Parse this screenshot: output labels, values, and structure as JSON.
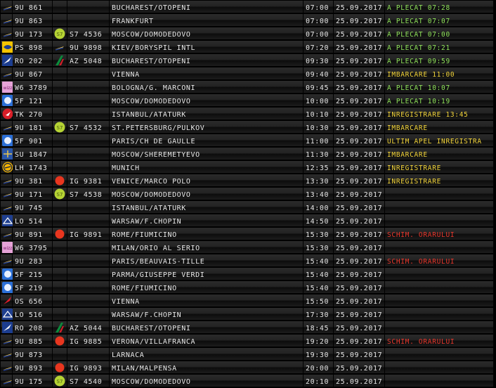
{
  "colors": {
    "status_green": "#8fe25a",
    "status_yellow": "#f2d43a",
    "status_red": "#e8362b",
    "text": "#e9e9e9"
  },
  "flights": [
    {
      "airline_icon": "tarom-icon",
      "flight": "9U 861",
      "codeshare_icon": "",
      "codeshare": "",
      "destination": "BUCHAREST/OTOPENI",
      "time": "07:00",
      "date": "25.09.2017",
      "status": "A PLECAT 07:28",
      "status_color": "green"
    },
    {
      "airline_icon": "tarom-icon",
      "flight": "9U 863",
      "codeshare_icon": "",
      "codeshare": "",
      "destination": "FRANKFURT",
      "time": "07:00",
      "date": "25.09.2017",
      "status": "A PLECAT 07:07",
      "status_color": "green"
    },
    {
      "airline_icon": "tarom-icon",
      "flight": "9U 173",
      "codeshare_icon": "s7-icon",
      "codeshare": "S7 4536",
      "destination": "MOSCOW/DOMODEDOVO",
      "time": "07:00",
      "date": "25.09.2017",
      "status": "A PLECAT 07:00",
      "status_color": "green"
    },
    {
      "airline_icon": "uia-icon",
      "flight": "PS 898",
      "codeshare_icon": "tarom-icon",
      "codeshare": "9U 9898",
      "destination": "KIEV/BORYSPIL INTL",
      "time": "07:20",
      "date": "25.09.2017",
      "status": "A PLECAT 07:21",
      "status_color": "green"
    },
    {
      "airline_icon": "tarom-ro-icon",
      "flight": "RO 202",
      "codeshare_icon": "alitalia-icon",
      "codeshare": "AZ 5048",
      "destination": "BUCHAREST/OTOPENI",
      "time": "09:30",
      "date": "25.09.2017",
      "status": "A PLECAT 09:59",
      "status_color": "green"
    },
    {
      "airline_icon": "tarom-icon",
      "flight": "9U 867",
      "codeshare_icon": "",
      "codeshare": "",
      "destination": "VIENNA",
      "time": "09:40",
      "date": "25.09.2017",
      "status": "IMBARCARE 11:00",
      "status_color": "yellow"
    },
    {
      "airline_icon": "wizz-icon",
      "flight": "W6 3789",
      "codeshare_icon": "",
      "codeshare": "",
      "destination": "BOLOGNA/G. MARCONI",
      "time": "09:45",
      "date": "25.09.2017",
      "status": "A PLECAT 10:07",
      "status_color": "green"
    },
    {
      "airline_icon": "s7-blue-icon",
      "flight": "5F 121",
      "codeshare_icon": "",
      "codeshare": "",
      "destination": "MOSCOW/DOMODEDOVO",
      "time": "10:00",
      "date": "25.09.2017",
      "status": "A PLECAT 10:19",
      "status_color": "green"
    },
    {
      "airline_icon": "turkish-icon",
      "flight": "TK 270",
      "codeshare_icon": "",
      "codeshare": "",
      "destination": "ISTANBUL/ATATURK",
      "time": "10:10",
      "date": "25.09.2017",
      "status": "INREGISTRARE 13:45",
      "status_color": "yellow"
    },
    {
      "airline_icon": "tarom-icon",
      "flight": "9U 181",
      "codeshare_icon": "s7-icon",
      "codeshare": "S7 4532",
      "destination": "ST.PETERSBURG/PULKOV",
      "time": "10:30",
      "date": "25.09.2017",
      "status": "IMBARCARE",
      "status_color": "yellow"
    },
    {
      "airline_icon": "s7-blue-icon",
      "flight": "5F 901",
      "codeshare_icon": "",
      "codeshare": "",
      "destination": "PARIS/CH DE GAULLE",
      "time": "11:00",
      "date": "25.09.2017",
      "status": "ULTIM APEL INREGISTRA",
      "status_color": "yellow"
    },
    {
      "airline_icon": "aeroflot-icon",
      "flight": "SU 1847",
      "codeshare_icon": "",
      "codeshare": "",
      "destination": "MOSCOW/SHEREMETYEVO",
      "time": "11:30",
      "date": "25.09.2017",
      "status": "IMBARCARE",
      "status_color": "yellow"
    },
    {
      "airline_icon": "lufthansa-icon",
      "flight": "LH 1743",
      "codeshare_icon": "",
      "codeshare": "",
      "destination": "MUNICH",
      "time": "12:35",
      "date": "25.09.2017",
      "status": "INREGISTRARE",
      "status_color": "yellow"
    },
    {
      "airline_icon": "tarom-icon",
      "flight": "9U 381",
      "codeshare_icon": "airone-icon",
      "codeshare": "IG 9381",
      "destination": "VENICE/MARCO POLO",
      "time": "13:30",
      "date": "25.09.2017",
      "status": "INREGISTRARE",
      "status_color": "yellow"
    },
    {
      "airline_icon": "tarom-icon",
      "flight": "9U 171",
      "codeshare_icon": "s7-icon",
      "codeshare": "S7 4538",
      "destination": "MOSCOW/DOMODEDOVO",
      "time": "13:40",
      "date": "25.09.2017",
      "status": "",
      "status_color": "yellow"
    },
    {
      "airline_icon": "tarom-icon",
      "flight": "9U 745",
      "codeshare_icon": "",
      "codeshare": "",
      "destination": "ISTANBUL/ATATURK",
      "time": "14:00",
      "date": "25.09.2017",
      "status": "",
      "status_color": "yellow"
    },
    {
      "airline_icon": "lot-icon",
      "flight": "LO 514",
      "codeshare_icon": "",
      "codeshare": "",
      "destination": "WARSAW/F.CHOPIN",
      "time": "14:50",
      "date": "25.09.2017",
      "status": "",
      "status_color": "yellow"
    },
    {
      "airline_icon": "tarom-icon",
      "flight": "9U 891",
      "codeshare_icon": "airone-icon",
      "codeshare": "IG 9891",
      "destination": "ROME/FIUMICINO",
      "time": "15:30",
      "date": "25.09.2017",
      "status": "SCHIM. ORARULUI",
      "status_color": "red"
    },
    {
      "airline_icon": "wizz-icon",
      "flight": "W6 3795",
      "codeshare_icon": "",
      "codeshare": "",
      "destination": "MILAN/ORIO AL SERIO",
      "time": "15:30",
      "date": "25.09.2017",
      "status": "",
      "status_color": "yellow"
    },
    {
      "airline_icon": "tarom-icon",
      "flight": "9U 283",
      "codeshare_icon": "",
      "codeshare": "",
      "destination": "PARIS/BEAUVAIS-TILLE",
      "time": "15:40",
      "date": "25.09.2017",
      "status": "SCHIM. ORARULUI",
      "status_color": "red"
    },
    {
      "airline_icon": "s7-blue-icon",
      "flight": "5F 215",
      "codeshare_icon": "",
      "codeshare": "",
      "destination": "PARMA/GIUSEPPE VERDI",
      "time": "15:40",
      "date": "25.09.2017",
      "status": "",
      "status_color": "yellow"
    },
    {
      "airline_icon": "s7-blue-icon",
      "flight": "5F 219",
      "codeshare_icon": "",
      "codeshare": "",
      "destination": "ROME/FIUMICINO",
      "time": "15:40",
      "date": "25.09.2017",
      "status": "",
      "status_color": "yellow"
    },
    {
      "airline_icon": "austrian-icon",
      "flight": "OS 656",
      "codeshare_icon": "",
      "codeshare": "",
      "destination": "VIENNA",
      "time": "15:50",
      "date": "25.09.2017",
      "status": "",
      "status_color": "yellow"
    },
    {
      "airline_icon": "lot-icon",
      "flight": "LO 516",
      "codeshare_icon": "",
      "codeshare": "",
      "destination": "WARSAW/F.CHOPIN",
      "time": "17:30",
      "date": "25.09.2017",
      "status": "",
      "status_color": "yellow"
    },
    {
      "airline_icon": "tarom-ro-icon",
      "flight": "RO 208",
      "codeshare_icon": "alitalia-icon",
      "codeshare": "AZ 5044",
      "destination": "BUCHAREST/OTOPENI",
      "time": "18:45",
      "date": "25.09.2017",
      "status": "",
      "status_color": "yellow"
    },
    {
      "airline_icon": "tarom-icon",
      "flight": "9U 885",
      "codeshare_icon": "airone-icon",
      "codeshare": "IG 9885",
      "destination": "VERONA/VILLAFRANCA",
      "time": "19:20",
      "date": "25.09.2017",
      "status": "SCHIM. ORARULUI",
      "status_color": "red"
    },
    {
      "airline_icon": "tarom-icon",
      "flight": "9U 873",
      "codeshare_icon": "",
      "codeshare": "",
      "destination": "LARNACA",
      "time": "19:30",
      "date": "25.09.2017",
      "status": "",
      "status_color": "yellow"
    },
    {
      "airline_icon": "tarom-icon",
      "flight": "9U 893",
      "codeshare_icon": "airone-icon",
      "codeshare": "IG 9893",
      "destination": "MILAN/MALPENSA",
      "time": "20:00",
      "date": "25.09.2017",
      "status": "",
      "status_color": "yellow"
    },
    {
      "airline_icon": "tarom-icon",
      "flight": "9U 175",
      "codeshare_icon": "s7-icon",
      "codeshare": "S7 4540",
      "destination": "MOSCOW/DOMODEDOVO",
      "time": "20:10",
      "date": "25.09.2017",
      "status": "",
      "status_color": "yellow"
    }
  ]
}
